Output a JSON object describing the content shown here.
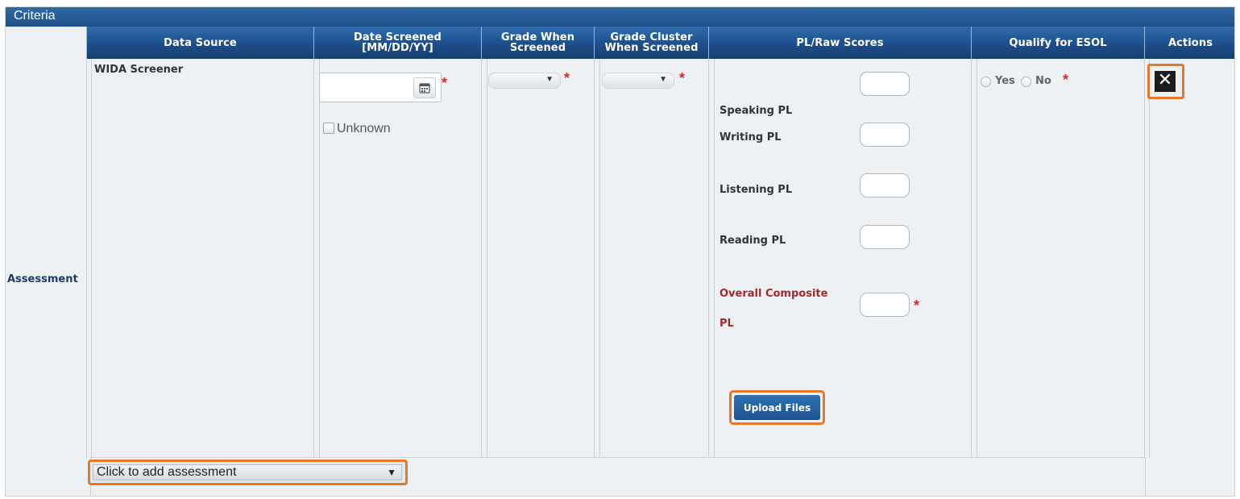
{
  "panel_title": "Criteria",
  "headers": {
    "data_source": "Data Source",
    "date_screened_line1": "Date Screened",
    "date_screened_line2": "[MM/DD/YY]",
    "grade_when_line1": "Grade When",
    "grade_when_line2": "Screened",
    "grade_cluster_line1": "Grade Cluster",
    "grade_cluster_line2": "When Screened",
    "pl_raw_scores": "PL/Raw Scores",
    "qualify_esol": "Qualify for ESOL",
    "actions": "Actions"
  },
  "row": {
    "label": "Assessment",
    "data_source": "WIDA Screener",
    "date_value": "",
    "unknown_label": "Unknown",
    "grade_when_value": "",
    "grade_cluster_value": "",
    "scores": [
      {
        "label": "Speaking PL",
        "value": ""
      },
      {
        "label": "Writing PL",
        "value": ""
      },
      {
        "label": "Listening PL",
        "value": ""
      },
      {
        "label": "Reading PL",
        "value": ""
      }
    ],
    "overall_line1": "Overall Composite",
    "overall_line2": "PL",
    "overall_value": "",
    "upload_label": "Upload Files",
    "qualify_yes": "Yes",
    "qualify_no": "No",
    "delete_symbol": "✕"
  },
  "required_mark": "*",
  "add_assessment_placeholder": "Click to add assessment",
  "dropdown_arrow": "▼",
  "colors": {
    "header_blue": "#1c4c86",
    "required_red": "#d62a2a",
    "highlight_orange": "#e5782a",
    "overall_label_red": "#a32a2a"
  }
}
